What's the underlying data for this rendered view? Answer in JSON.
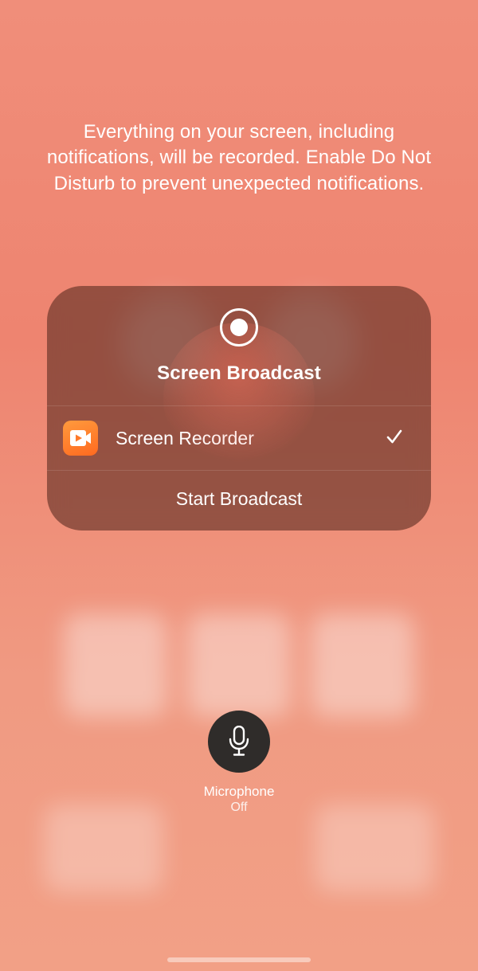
{
  "info_text": "Everything on your screen, including notifications, will be recorded. Enable Do Not Disturb to prevent unexpected notifications.",
  "card": {
    "title": "Screen Broadcast",
    "app_label": "Screen Recorder",
    "action_label": "Start Broadcast"
  },
  "microphone": {
    "label": "Microphone",
    "state": "Off"
  }
}
